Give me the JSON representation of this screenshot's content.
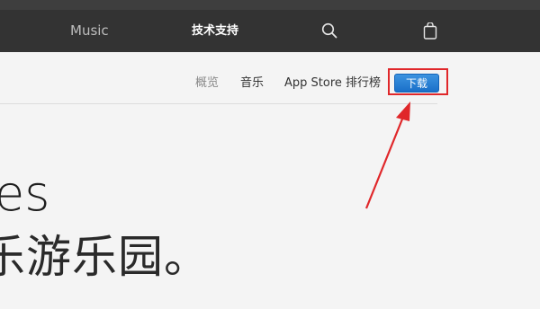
{
  "globalnav": {
    "music_label": "Music",
    "support_label": "技术支持",
    "search_icon": "search-icon",
    "bag_icon": "shopping-bag-icon"
  },
  "localnav": {
    "overview_label": "概览",
    "music_label": "音乐",
    "charts_label": "App Store 排行榜",
    "download_label": "下载"
  },
  "hero": {
    "line1": "es",
    "line2": "乐游乐园。"
  },
  "colors": {
    "nav_bg": "#333333",
    "download_button": "#1a70c9",
    "annotation_red": "#e0272a"
  }
}
